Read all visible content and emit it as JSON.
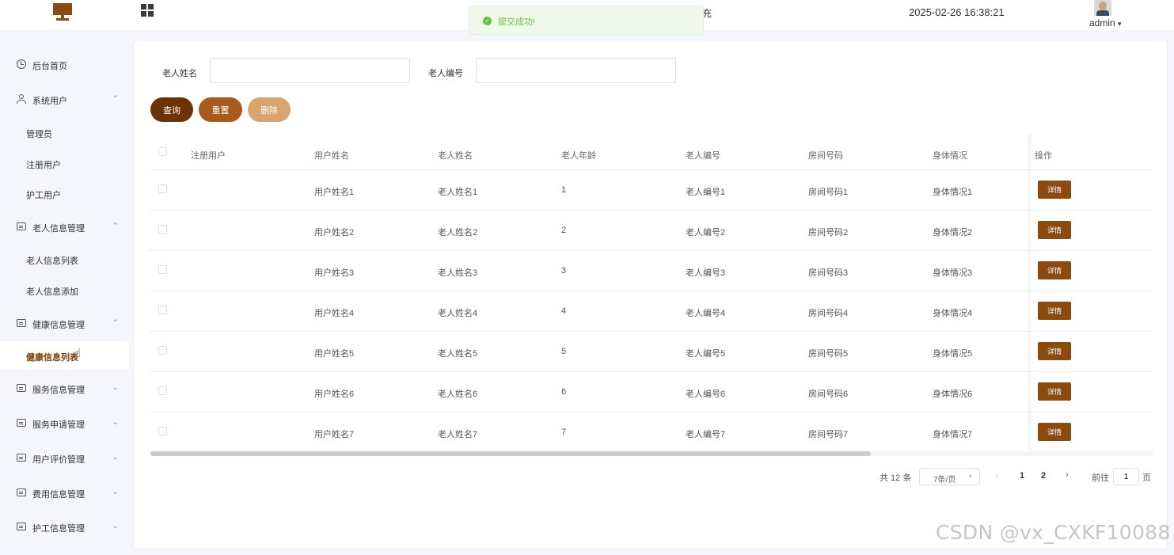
{
  "header": {
    "title_fragment": "充",
    "datetime": "2025-02-26 16:38:21",
    "username": "admin",
    "user_caret": "▾"
  },
  "toast": {
    "icon": "check-circle-icon",
    "message": "提交成功!"
  },
  "sidebar": {
    "items": [
      {
        "label": "后台首页",
        "icon": "clock-icon",
        "chevron": ""
      },
      {
        "label": "系统用户",
        "icon": "user-icon",
        "chevron": "⌃"
      },
      {
        "label": "管理员",
        "sub": true
      },
      {
        "label": "注册用户",
        "sub": true
      },
      {
        "label": "护工用户",
        "sub": true
      },
      {
        "label": "老人信息管理",
        "icon": "card-icon",
        "chevron": "⌃"
      },
      {
        "label": "老人信息列表",
        "sub": true
      },
      {
        "label": "老人信息添加",
        "sub": true
      },
      {
        "label": "健康信息管理",
        "icon": "card-icon",
        "chevron": "⌃"
      },
      {
        "label": "健康信息列表",
        "sub": true,
        "active": true
      },
      {
        "label": "服务信息管理",
        "icon": "card-icon",
        "chevron": "⌄"
      },
      {
        "label": "服务申请管理",
        "icon": "card-icon",
        "chevron": "⌄"
      },
      {
        "label": "用户评价管理",
        "icon": "card-icon",
        "chevron": "⌄"
      },
      {
        "label": "费用信息管理",
        "icon": "card-icon",
        "chevron": "⌄"
      },
      {
        "label": "护工信息管理",
        "icon": "card-icon",
        "chevron": "⌄"
      }
    ]
  },
  "filters": {
    "name_label": "老人姓名",
    "name_value": "",
    "number_label": "老人编号",
    "number_value": ""
  },
  "actions": {
    "query": "查询",
    "reset": "重置",
    "delete": "删除",
    "colors": {
      "query": "#6b3306",
      "reset": "#a85a1c",
      "delete": "#d9a46e"
    }
  },
  "table": {
    "headers": [
      "注册用户",
      "用户姓名",
      "老人姓名",
      "老人年龄",
      "老人编号",
      "房间号码",
      "身体情况",
      "操作"
    ],
    "detail_label": "详情",
    "detail_color": "#8b4a0f",
    "rows": [
      {
        "reg_user": "",
        "user_name": "用户姓名1",
        "elder_name": "老人姓名1",
        "age": "1",
        "elder_no": "老人编号1",
        "room": "房间号码1",
        "health": "身体情况1"
      },
      {
        "reg_user": "",
        "user_name": "用户姓名2",
        "elder_name": "老人姓名2",
        "age": "2",
        "elder_no": "老人编号2",
        "room": "房间号码2",
        "health": "身体情况2"
      },
      {
        "reg_user": "",
        "user_name": "用户姓名3",
        "elder_name": "老人姓名3",
        "age": "3",
        "elder_no": "老人编号3",
        "room": "房间号码3",
        "health": "身体情况3"
      },
      {
        "reg_user": "",
        "user_name": "用户姓名4",
        "elder_name": "老人姓名4",
        "age": "4",
        "elder_no": "老人编号4",
        "room": "房间号码4",
        "health": "身体情况4"
      },
      {
        "reg_user": "",
        "user_name": "用户姓名5",
        "elder_name": "老人姓名5",
        "age": "5",
        "elder_no": "老人编号5",
        "room": "房间号码5",
        "health": "身体情况5"
      },
      {
        "reg_user": "",
        "user_name": "用户姓名6",
        "elder_name": "老人姓名6",
        "age": "6",
        "elder_no": "老人编号6",
        "room": "房间号码6",
        "health": "身体情况6"
      },
      {
        "reg_user": "",
        "user_name": "用户姓名7",
        "elder_name": "老人姓名7",
        "age": "7",
        "elder_no": "老人编号7",
        "room": "房间号码7",
        "health": "身体情况7"
      }
    ]
  },
  "pagination": {
    "total": "共 12 条",
    "page_size": "7条/页",
    "pages": [
      "1",
      "2"
    ],
    "goto_label": "前往",
    "goto_value": "1",
    "page_unit": "页"
  },
  "watermark": "CSDN @vx_CXKF10088"
}
